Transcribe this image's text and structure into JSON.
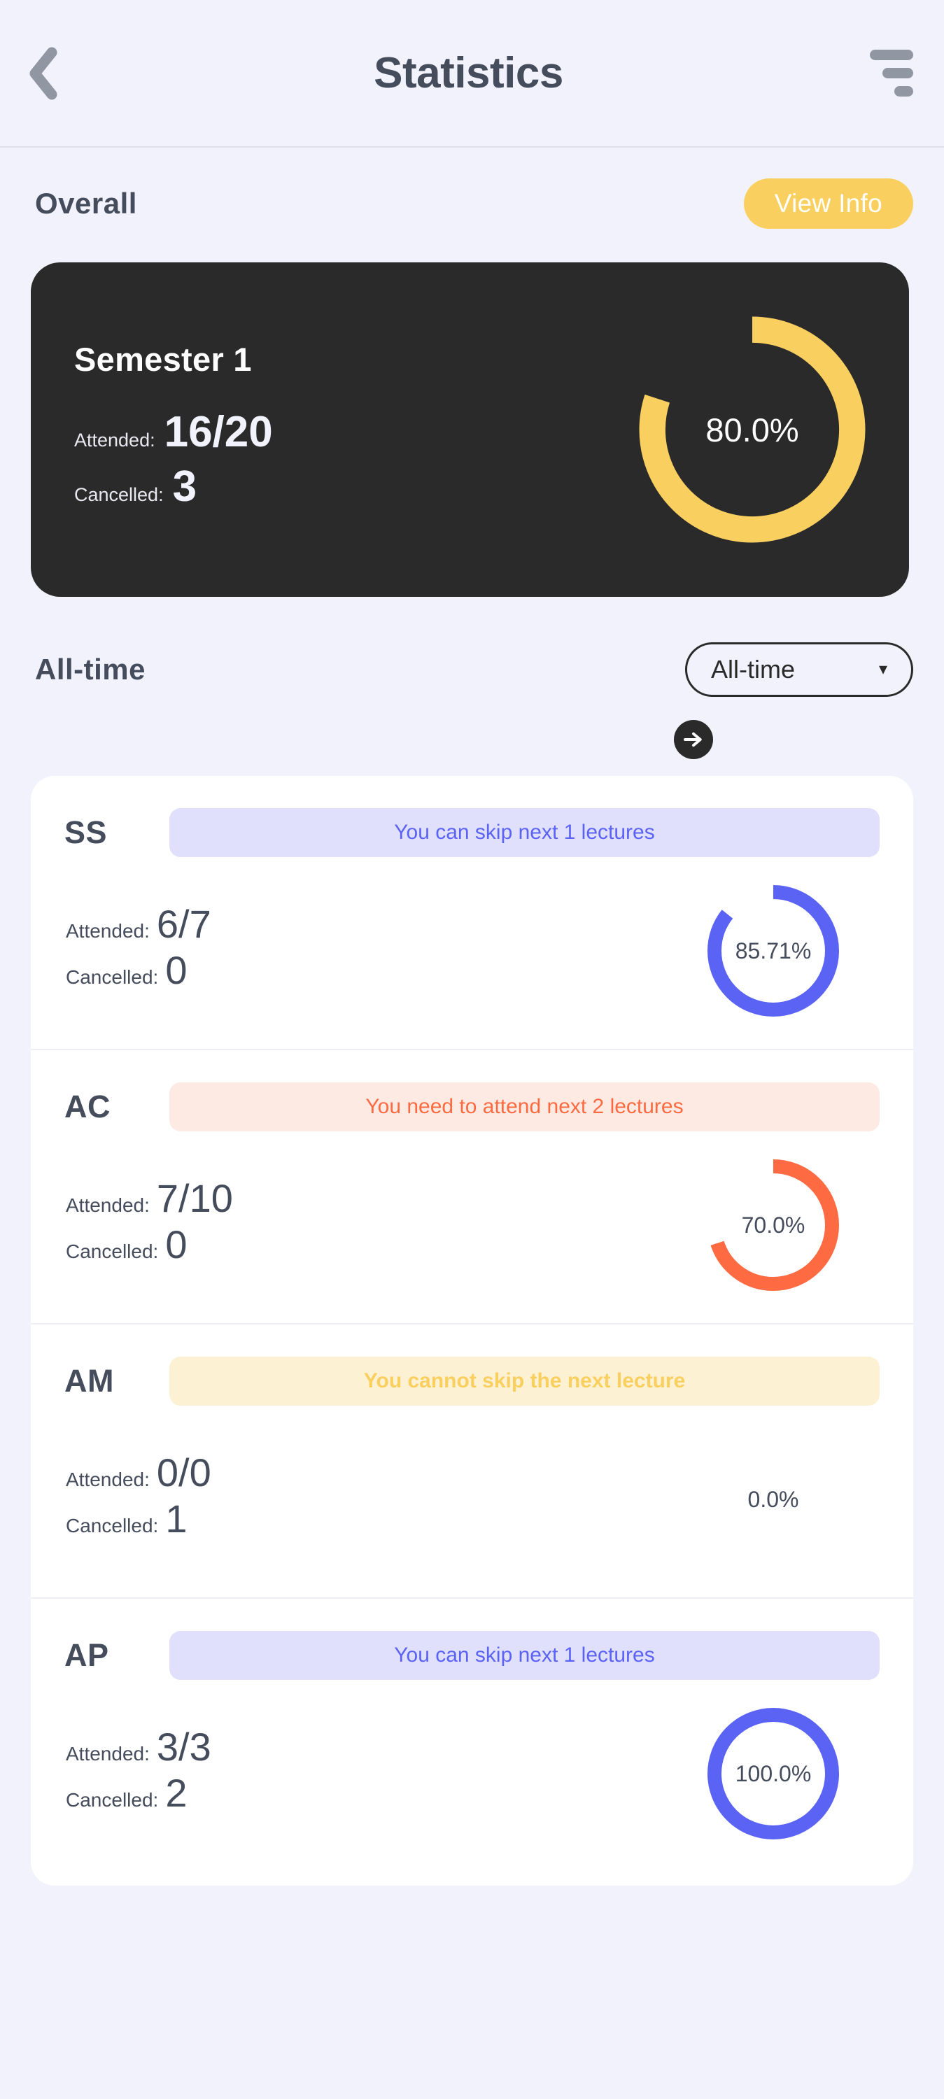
{
  "header": {
    "title": "Statistics",
    "back_icon": "chevron-left-icon",
    "menu_icon": "filter-sort-icon"
  },
  "overall": {
    "section_title": "Overall",
    "view_info_label": "View Info",
    "card": {
      "title": "Semester 1",
      "attended_label": "Attended:",
      "attended_value": "16/20",
      "cancelled_label": "Cancelled:",
      "cancelled_value": "3",
      "percent_label": "80.0%",
      "percent": 80,
      "ring_color": "#f9cf5f",
      "card_bg": "#2b2a2a"
    }
  },
  "alltime": {
    "section_title": "All-time",
    "select_value": "All-time",
    "select_caret": "▾",
    "select_options": [
      "All-time"
    ],
    "next_arrow_icon": "arrow-right-circle-icon"
  },
  "subjects": [
    {
      "code": "SS",
      "badge_text": "You can skip next 1 lectures",
      "badge_kind": "skip",
      "badge_bg": "#e0e0fd",
      "badge_color": "#5b63f5",
      "attended_label": "Attended:",
      "attended_value": "6/7",
      "cancelled_label": "Cancelled:",
      "cancelled_value": "0",
      "percent_label": "85.71%",
      "percent": 85.71,
      "ring_color": "#5b63f5",
      "has_ring": true
    },
    {
      "code": "AC",
      "badge_text": "You need to attend next 2 lectures",
      "badge_kind": "attend",
      "badge_bg": "#fdeae3",
      "badge_color": "#fe6b42",
      "attended_label": "Attended:",
      "attended_value": "7/10",
      "cancelled_label": "Cancelled:",
      "cancelled_value": "0",
      "percent_label": "70.0%",
      "percent": 70,
      "ring_color": "#fe6b42",
      "has_ring": true
    },
    {
      "code": "AM",
      "badge_text": "You cannot skip the next lecture",
      "badge_kind": "cannot",
      "badge_bg": "#fdf1d4",
      "badge_color": "#f9cf5f",
      "attended_label": "Attended:",
      "attended_value": "0/0",
      "cancelled_label": "Cancelled:",
      "cancelled_value": "1",
      "percent_label": "0.0%",
      "percent": 0,
      "ring_color": "#f9cf5f",
      "has_ring": false
    },
    {
      "code": "AP",
      "badge_text": "You can skip next 1 lectures",
      "badge_kind": "skip",
      "badge_bg": "#e0e0fd",
      "badge_color": "#5b63f5",
      "attended_label": "Attended:",
      "attended_value": "3/3",
      "cancelled_label": "Cancelled:",
      "cancelled_value": "2",
      "percent_label": "100.0%",
      "percent": 100,
      "ring_color": "#5b63f5",
      "has_ring": true
    }
  ],
  "theme": {
    "page_bg": "#f2f2fc",
    "card_bg": "#ffffff",
    "text": "#454c5c",
    "accent_yellow": "#f9cf5f",
    "accent_blue": "#5b63f5",
    "accent_orange": "#fe6b42",
    "dark": "#2b2a2a"
  }
}
